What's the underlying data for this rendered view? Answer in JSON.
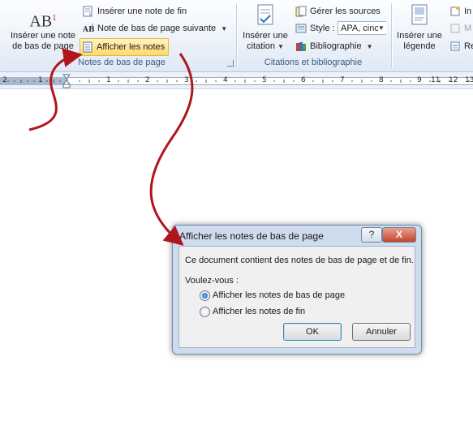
{
  "ribbon": {
    "footnotes_group": {
      "label": "Notes de bas de page",
      "insert_footnote": {
        "line1": "Insérer une note",
        "line2": "de bas de page"
      },
      "insert_endnote": "Insérer une note de fin",
      "next_footnote": "Note de bas de page suivante",
      "show_notes": "Afficher les notes"
    },
    "citations_group": {
      "label": "Citations et bibliographie",
      "insert_citation": {
        "line1": "Insérer une",
        "line2": "citation"
      },
      "manage_sources": "Gérer les sources",
      "style_label": "Style :",
      "style_value": "APA, cinc",
      "bibliography": "Bibliographie"
    },
    "captions_group": {
      "insert_caption": {
        "line1": "Insérer une",
        "line2": "légende"
      },
      "partial_items": [
        "In",
        "M",
        "Re"
      ]
    },
    "icon_text": {
      "ab": "AB",
      "sup": "1"
    }
  },
  "ruler": {
    "numbers": [
      "2",
      "1",
      "1",
      "2",
      "3",
      "4",
      "5",
      "6",
      "7",
      "8",
      "9",
      "10",
      "11",
      "12",
      "13"
    ]
  },
  "dialog": {
    "title": "Afficher les notes de bas de page",
    "help": "?",
    "close": "X",
    "message": "Ce document contient des notes de bas de page et de fin.",
    "question": "Voulez-vous :",
    "options": [
      {
        "label": "Afficher les notes de bas de page",
        "selected": true
      },
      {
        "label": "Afficher les notes de fin",
        "selected": false
      }
    ],
    "ok": "OK",
    "cancel": "Annuler"
  },
  "colors": {
    "arrow": "#b0161c",
    "highlight": "#ffd96a",
    "ribbon": "#eef3fa"
  }
}
